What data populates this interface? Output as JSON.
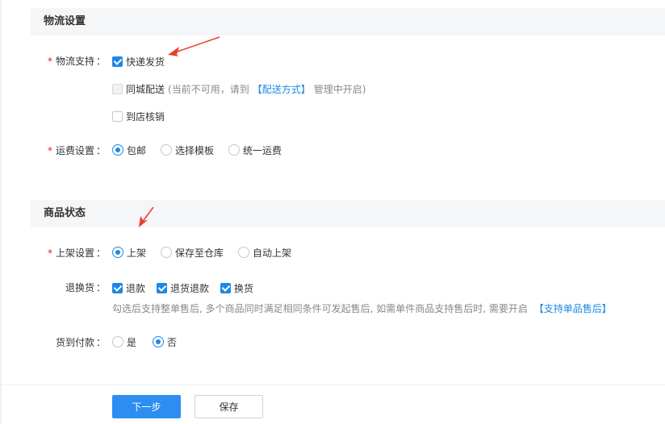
{
  "logistics_section": {
    "title": "物流设置",
    "support_label": "物流支持",
    "options": {
      "express": "快递发货",
      "same_city": "同城配送",
      "same_city_note_prefix": "(当前不可用，请到",
      "same_city_link": "【配送方式】",
      "same_city_note_suffix": "管理中开启)",
      "store_pickup": "到店核销"
    },
    "freight_label": "运费设置",
    "freight_options": [
      "包邮",
      "选择模板",
      "统一运费"
    ],
    "freight_selected": "包邮"
  },
  "status_section": {
    "title": "商品状态",
    "listing_label": "上架设置",
    "listing_options": [
      "上架",
      "保存至仓库",
      "自动上架"
    ],
    "listing_selected": "上架",
    "return_label": "退换货",
    "return_options": [
      "退款",
      "退货退款",
      "换货"
    ],
    "return_hint_prefix": "勾选后支持整单售后, 多个商品同时满足相同条件可发起售后, 如需单件商品支持售后时, 需要开启",
    "return_hint_link": "【支持单品售后】",
    "cod_label": "货到付款",
    "cod_options": [
      "是",
      "否"
    ],
    "cod_selected": "否"
  },
  "footer": {
    "next_label": "下一步",
    "save_label": "保存"
  },
  "colors": {
    "accent": "#1e88e5",
    "required": "#e02020",
    "annotation_arrow": "#e8412c"
  }
}
